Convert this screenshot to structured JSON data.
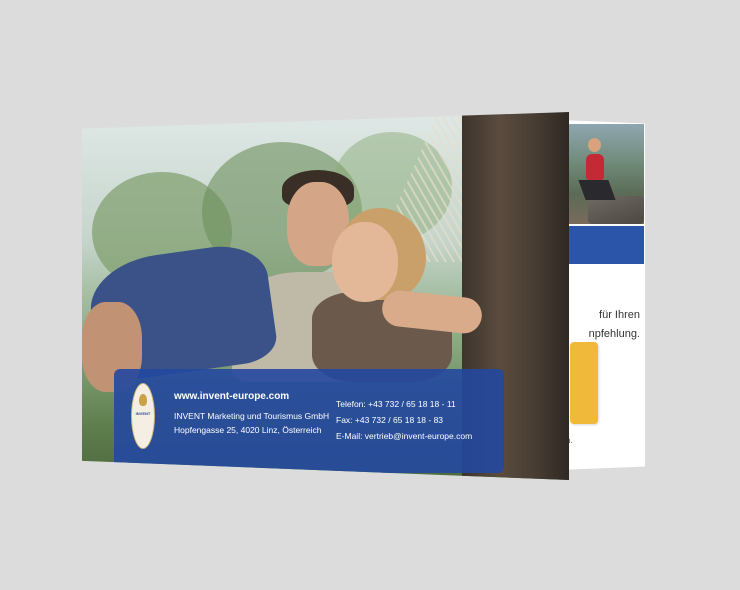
{
  "brochure": {
    "company_url": "www.invent-europe.com",
    "company_name": "INVENT Marketing und Tourismus GmbH",
    "address": "Hopfengasse 25, 4020 Linz, Österreich",
    "telefon": "Telefon: +43 732 / 65 18 18 - 11",
    "fax": "Fax: +43 732 / 65 18 18 - 83",
    "email": "E-Mail: vertrieb@invent-europe.com",
    "logo_text": "INVENT"
  },
  "inner_panel": {
    "text_line1": "für Ihren",
    "text_line2": "npfehlung.",
    "small_text": "n."
  },
  "colors": {
    "background": "#dcdcdc",
    "info_box": "#2348a0",
    "accent_blue": "#2a55a8",
    "accent_gold": "#f0b93a"
  }
}
